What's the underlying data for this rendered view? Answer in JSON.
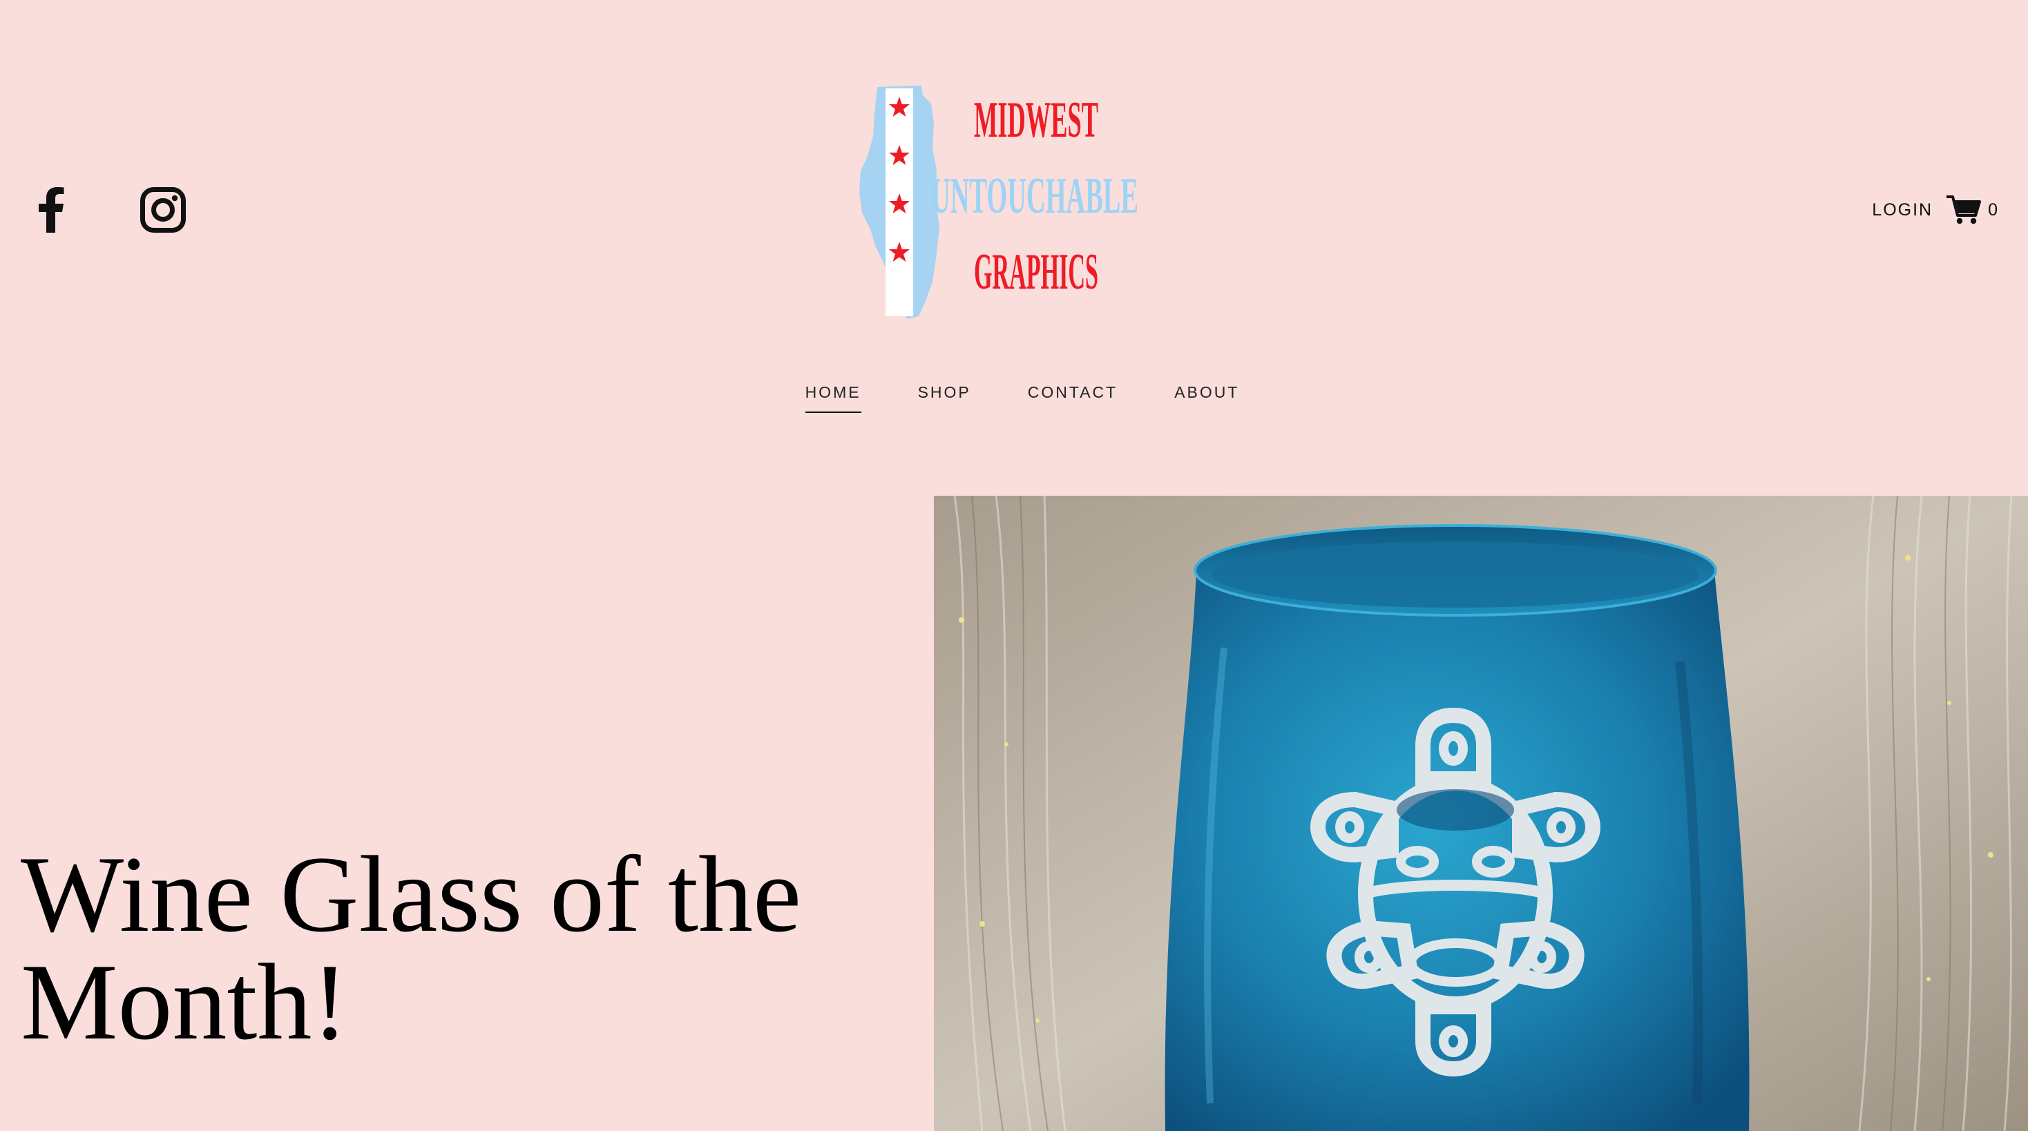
{
  "logo": {
    "line1": "MIDWEST",
    "line2": "UNTOUCHABLE",
    "line3": "GRAPHICS",
    "colors": {
      "red": "#ee1c25",
      "light_blue": "#9ed3f5"
    }
  },
  "social": [
    {
      "icon": "facebook-icon"
    },
    {
      "icon": "instagram-icon"
    }
  ],
  "header": {
    "login_label": "LOGIN",
    "cart_count": "0"
  },
  "nav": {
    "items": [
      {
        "label": "Home",
        "active": true
      },
      {
        "label": "Shop",
        "active": false
      },
      {
        "label": "Contact",
        "active": false
      },
      {
        "label": "About",
        "active": false
      }
    ]
  },
  "hero": {
    "title": "Wine Glass of the Month!"
  },
  "colors": {
    "background": "#f9dedb",
    "glass_blue": "#1b86b0",
    "etching": "#dfe6ea"
  }
}
